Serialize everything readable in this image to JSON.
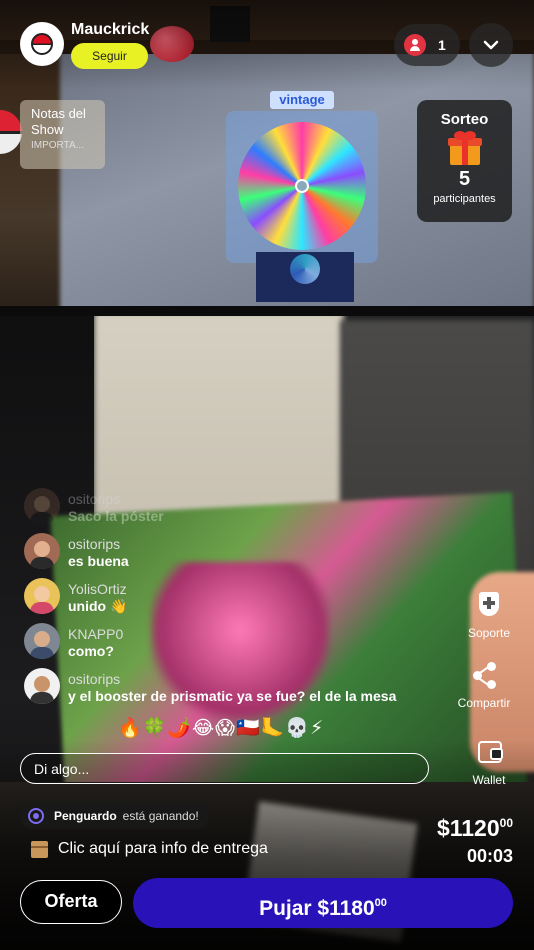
{
  "header": {
    "username": "Mauckrick",
    "follow_label": "Seguir",
    "viewer_count": "1"
  },
  "overlay": {
    "wheel_label": "vintage"
  },
  "notes": {
    "title": "Notas del Show",
    "subtitle": "IMPORTA..."
  },
  "raffle": {
    "title": "Sorteo",
    "count": "5",
    "label": "participantes"
  },
  "chat": {
    "messages": [
      {
        "user": "ositorips",
        "text": "Saco la póster"
      },
      {
        "user": "ositorips",
        "text": "es buena"
      },
      {
        "user": "YolisOrtiz",
        "text": "unido 👋"
      },
      {
        "user": "KNAPP0",
        "text": "como?"
      },
      {
        "user": "ositorips",
        "text": "y el booster de prismatic ya se fue? el de la mesa"
      }
    ],
    "emojis": "🔥🍀🌶️😂😱🇨🇱🦶💀⚡",
    "input_placeholder": "Di algo..."
  },
  "actions": {
    "support": "Soporte",
    "share": "Compartir",
    "wallet": "Wallet"
  },
  "auction": {
    "winner_name": "Penguardo",
    "winner_text": "está ganando!",
    "delivery_link": "Clic aquí para info de entrega",
    "price_main": "$1120",
    "price_cents": "00",
    "timer": "00:03",
    "offer_label": "Oferta",
    "bid_label": "Pujar $1180",
    "bid_cents": "00"
  },
  "colors": {
    "follow": "#e7f123",
    "bid_button": "#2812b8",
    "viewer_dot": "#e23342"
  }
}
